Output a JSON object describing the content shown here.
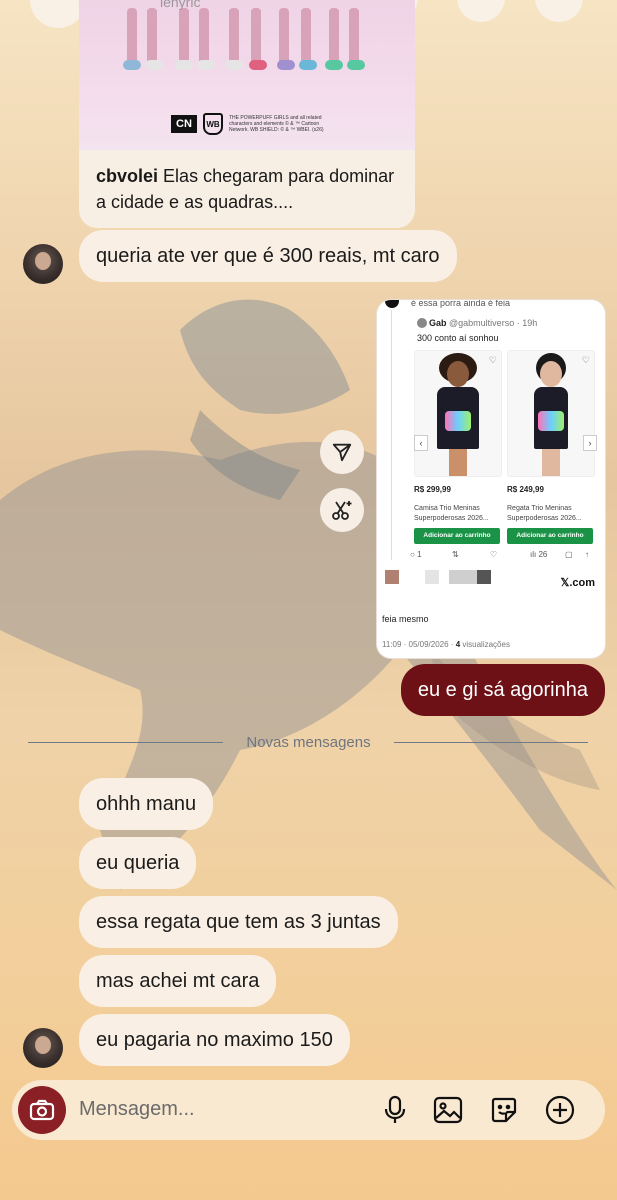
{
  "shared_reel": {
    "handle": "lenyric",
    "username": "cbvolei",
    "caption": "Elas chegaram para dominar a cidade e as quadras....",
    "logo_text": "CN",
    "wb_text": "WB",
    "legal": "THE POWERPUFF GIRLS and all related characters and elements © & ™ Cartoon Network. WB SHIELD: © & ™ WBEI. (s26)"
  },
  "messages_before": [
    {
      "text": "queria ate ver que é 300 reais, mt caro"
    }
  ],
  "shared_post": {
    "top_text": "é essa porra ainda é feia",
    "author": "Gab",
    "handle": "@gabmultiverso",
    "time": "19h",
    "text": "300 conto aí sonhou",
    "products": [
      {
        "price": "R$ 299,99",
        "name_line1": "Camisa Trio Meninas",
        "name_line2": "Superpoderosas 2026...",
        "cta": "Adicionar ao carrinho"
      },
      {
        "price": "R$ 249,99",
        "name_line1": "Regata Trio Meninas",
        "name_line2": "Superpoderosas 2026...",
        "cta": "Adicionar ao carrinho"
      }
    ],
    "stats": {
      "replies": "1",
      "views": "26"
    },
    "source": "𝕏.com",
    "reply_text": "feia mesmo",
    "meta_time": "11:09 · 05/09/2026 · ",
    "meta_views": "4",
    "meta_views_label": " visualizações"
  },
  "sent_message": "eu e gi sá agorinha",
  "divider_label": "Novas mensagens",
  "messages_after": [
    "ohhh manu",
    "eu queria",
    "essa regata que tem as 3 juntas",
    "mas achei mt cara",
    "eu pagaria no maximo 150"
  ],
  "composer": {
    "placeholder": "Mensagem..."
  },
  "colors": {
    "sent_bubble": "#6e1117",
    "received_bubble": "#f9efe4",
    "camera_button": "#8b1f26",
    "add_to_cart": "#1b9347"
  }
}
